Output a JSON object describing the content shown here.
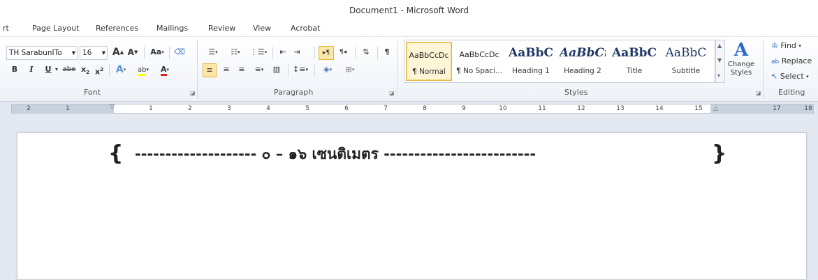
{
  "window": {
    "title": "Document1  -  Microsoft Word"
  },
  "tabs": [
    "rt",
    "Page Layout",
    "References",
    "Mailings",
    "Review",
    "View",
    "Acrobat"
  ],
  "ribbon": {
    "font": {
      "font_name": "TH SarabunITo",
      "font_size": "16",
      "grow_font": "A",
      "shrink_font": "A",
      "change_case": "Aa",
      "bold": "B",
      "italic": "I",
      "underline": "U",
      "strikethrough": "abe",
      "subscript": "x",
      "superscript": "x",
      "highlight_text": "ab",
      "font_color_text": "A",
      "group_label": "Font"
    },
    "paragraph": {
      "group_label": "Paragraph"
    },
    "styles": {
      "items": [
        {
          "sample": "AaBbCcDc",
          "name": "¶ Normal"
        },
        {
          "sample": "AaBbCcDc",
          "name": "¶ No Spaci..."
        },
        {
          "sample": "AaBbC",
          "name": "Heading 1"
        },
        {
          "sample": "AaBbCi",
          "name": "Heading 2"
        },
        {
          "sample": "AaBbC",
          "name": "Title"
        },
        {
          "sample": "AaBbC",
          "name": "Subtitle"
        }
      ],
      "change_styles": "Change Styles",
      "group_label": "Styles"
    },
    "editing": {
      "find": "Find",
      "replace": "Replace",
      "select": "Select",
      "group_label": "Editing"
    }
  },
  "ruler": {
    "labels": [
      "2",
      "1",
      "1",
      "2",
      "3",
      "4",
      "5",
      "6",
      "7",
      "8",
      "9",
      "10",
      "11",
      "12",
      "13",
      "14",
      "15",
      "17",
      "18"
    ]
  },
  "document": {
    "line": "-------------------- ๐ – ๑๖ เซนติเมตร -------------------------",
    "open_brace": "{",
    "close_brace": "}"
  },
  "colors": {
    "accent_selected": "#fde7a8",
    "heading_blue": "#1f3864",
    "text_highlight": "#ffff00",
    "font_color_red": "#e02020"
  }
}
